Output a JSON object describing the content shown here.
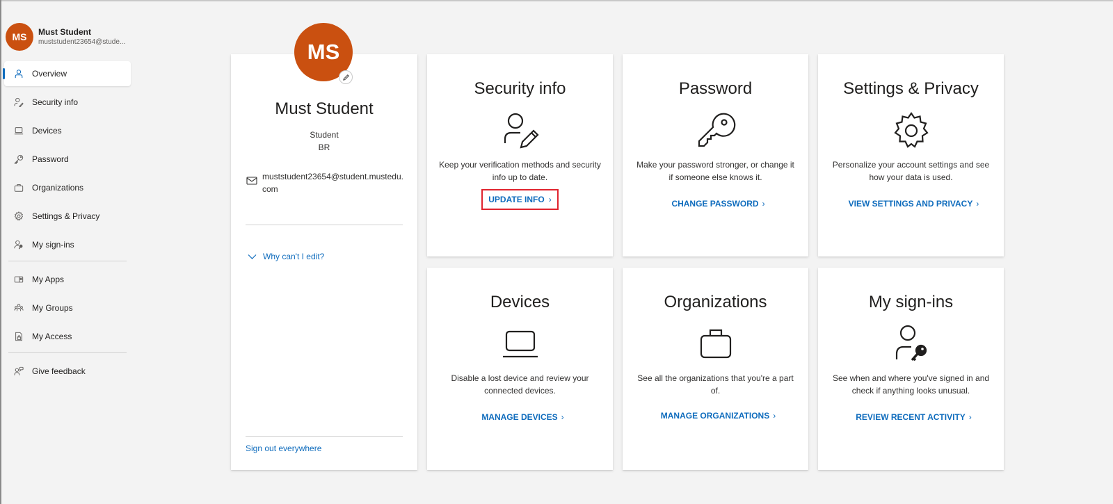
{
  "sidebar": {
    "user": {
      "initials": "MS",
      "name": "Must Student",
      "email": "muststudent23654@stude..."
    },
    "items": [
      {
        "label": "Overview",
        "icon": "person-icon",
        "active": true
      },
      {
        "label": "Security info",
        "icon": "person-key-icon"
      },
      {
        "label": "Devices",
        "icon": "laptop-icon"
      },
      {
        "label": "Password",
        "icon": "key-icon"
      },
      {
        "label": "Organizations",
        "icon": "briefcase-icon"
      },
      {
        "label": "Settings & Privacy",
        "icon": "gear-icon"
      },
      {
        "label": "My sign-ins",
        "icon": "person-signin-icon"
      }
    ],
    "apps": [
      {
        "label": "My Apps",
        "icon": "apps-icon"
      },
      {
        "label": "My Groups",
        "icon": "groups-icon"
      },
      {
        "label": "My Access",
        "icon": "access-icon"
      }
    ],
    "feedback": {
      "label": "Give feedback",
      "icon": "feedback-icon"
    }
  },
  "profile": {
    "initials": "MS",
    "name": "Must Student",
    "role": "Student",
    "country": "BR",
    "email": "muststudent23654@student.mustedu.com",
    "why_label": "Why can't I edit?",
    "signout_label": "Sign out everywhere"
  },
  "tiles": [
    {
      "title": "Security info",
      "icon": "person-pen-icon",
      "description": "Keep your verification methods and security info up to date.",
      "link": "UPDATE INFO"
    },
    {
      "title": "Password",
      "icon": "key-icon",
      "description": "Make your password stronger, or change it if someone else knows it.",
      "link": "CHANGE PASSWORD"
    },
    {
      "title": "Settings & Privacy",
      "icon": "gear-icon",
      "description": "Personalize your account settings and see how your data is used.",
      "link": "VIEW SETTINGS AND PRIVACY"
    },
    {
      "title": "Devices",
      "icon": "laptop-icon",
      "description": "Disable a lost device and review your connected devices.",
      "link": "MANAGE DEVICES"
    },
    {
      "title": "Organizations",
      "icon": "briefcase-icon",
      "description": "See all the organizations that you're a part of.",
      "link": "MANAGE ORGANIZATIONS"
    },
    {
      "title": "My sign-ins",
      "icon": "person-key-icon",
      "description": "See when and where you've signed in and check if anything looks unusual.",
      "link": "REVIEW RECENT ACTIVITY"
    }
  ],
  "colors": {
    "accent": "#0f6cbd",
    "avatar": "#ca5010",
    "highlight": "#e0232e",
    "background": "#f3f3f3"
  }
}
